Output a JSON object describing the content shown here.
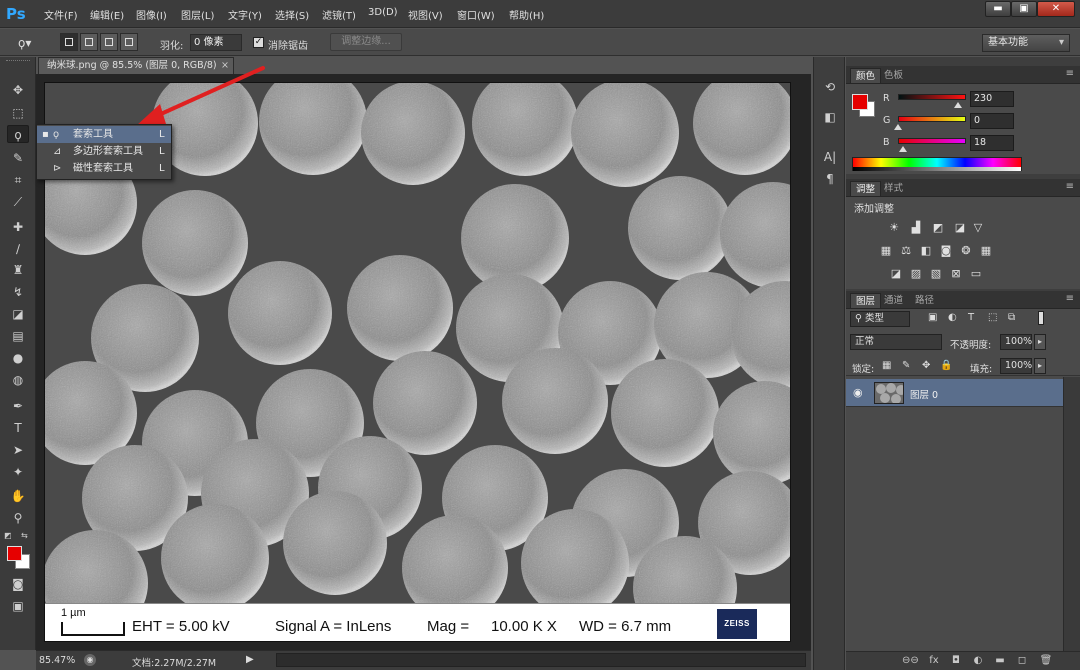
{
  "app": {
    "logo": "Ps"
  },
  "menu": [
    "文件(F)",
    "编辑(E)",
    "图像(I)",
    "图层(L)",
    "文字(Y)",
    "选择(S)",
    "滤镜(T)",
    "3D(D)",
    "视图(V)",
    "窗口(W)",
    "帮助(H)"
  ],
  "window_controls": {
    "minimize": "▬",
    "restore": "▣",
    "close": "✕"
  },
  "options": {
    "feather_label": "羽化:",
    "feather_value": "0 像素",
    "antialias_label": "消除锯齿",
    "antialias_checked": "✓",
    "refine_edge": "调整边缘...",
    "workspace": "基本功能"
  },
  "document": {
    "tab_title": "纳米球.png @ 85.5% (图层 0, RGB/8)",
    "tab_close": "×"
  },
  "sem": {
    "scale_label": "1 µm",
    "eht": "EHT =  5.00 kV",
    "signal": "Signal A = InLens",
    "mag_label": "Mag =",
    "mag_value": "10.00 K X",
    "wd": "WD =  6.7 mm",
    "logo": "ZEISS"
  },
  "flyout": [
    {
      "name": "套索工具",
      "key": "L",
      "icon": "lasso-icon",
      "selected": true
    },
    {
      "name": "多边形套索工具",
      "key": "L",
      "icon": "polygonal-lasso-icon",
      "selected": false
    },
    {
      "name": "磁性套索工具",
      "key": "L",
      "icon": "magnetic-lasso-icon",
      "selected": false
    }
  ],
  "status": {
    "zoom": "85.47%",
    "doc_size": "文档:2.27M/2.27M"
  },
  "color_panel": {
    "tabs": [
      "颜色",
      "色板"
    ],
    "channels": [
      {
        "label": "R",
        "value": "230"
      },
      {
        "label": "G",
        "value": "0"
      },
      {
        "label": "B",
        "value": "18"
      }
    ],
    "foreground": "#e60012",
    "background": "#ffffff"
  },
  "adjust_panel": {
    "tabs": [
      "调整",
      "样式"
    ],
    "title": "添加调整"
  },
  "layers_panel": {
    "tabs": [
      "图层",
      "通道",
      "路径"
    ],
    "filter": "类型",
    "blend_mode": "正常",
    "opacity_label": "不透明度:",
    "opacity_value": "100%",
    "lock_label": "锁定:",
    "fill_label": "填充:",
    "fill_value": "100%",
    "layers": [
      {
        "name": "图层 0",
        "visible": true
      }
    ]
  },
  "icons": {
    "toolbar": [
      "move-icon",
      "marquee-icon",
      "lasso-icon",
      "quick-select-icon",
      "crop-icon",
      "eyedropper-icon",
      "healing-brush-icon",
      "brush-icon",
      "clone-stamp-icon",
      "history-brush-icon",
      "eraser-icon",
      "gradient-icon",
      "blur-icon",
      "dodge-icon",
      "pen-icon",
      "type-icon",
      "path-select-icon",
      "shape-icon",
      "hand-icon",
      "zoom-icon"
    ]
  },
  "colors": {
    "accent_selection": "#5a6e8c",
    "annotation_arrow": "#e02020"
  }
}
